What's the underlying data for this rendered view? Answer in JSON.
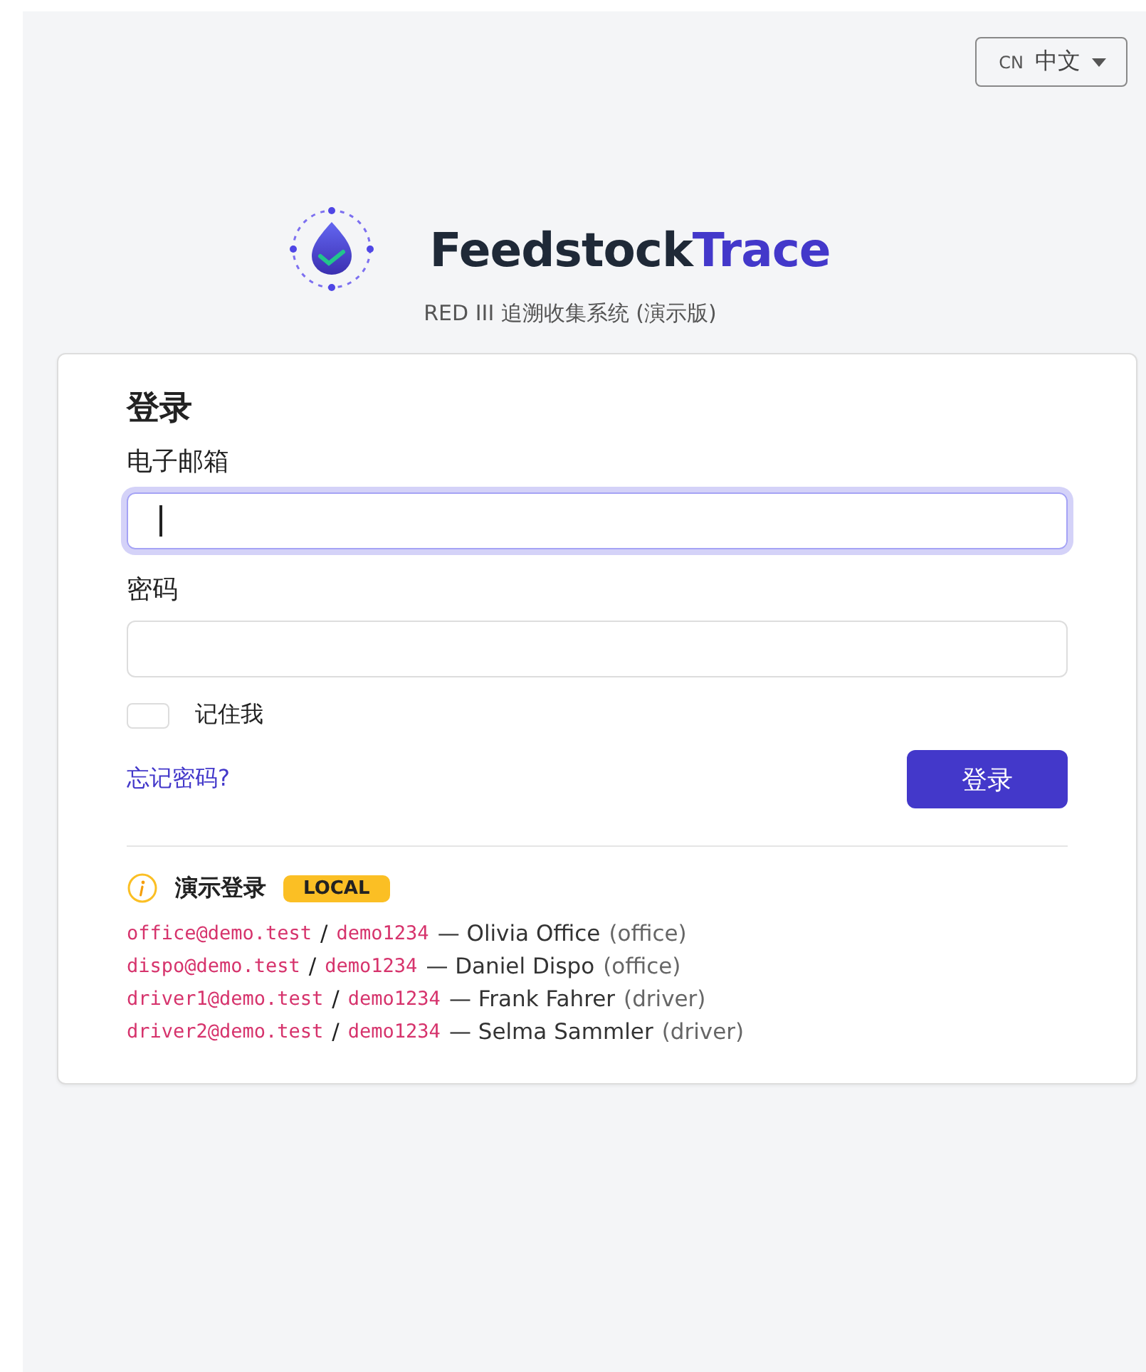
{
  "language": {
    "code": "CN",
    "label": "中文"
  },
  "brand": {
    "name": "Feedstock",
    "accent": "Trace",
    "subtitle": "RED III 追溯收集系统 (演示版)"
  },
  "login": {
    "title": "登录",
    "fields": [
      {
        "label": "电子邮箱",
        "focused": true
      },
      {
        "label": "密码",
        "focused": false
      }
    ],
    "remember": {
      "label": "记住我",
      "checked": false
    },
    "forgot_link": "忘记密码?",
    "submit": "登录"
  },
  "demo": {
    "title": "演示登录",
    "badge": "LOCAL",
    "accounts": [
      {
        "email": "office@demo.test",
        "slash": "/",
        "password": "demo1234",
        "person": "— Olivia Office",
        "role": "(office)"
      },
      {
        "email": "dispo@demo.test",
        "slash": "/",
        "password": "demo1234",
        "person": "— Daniel Dispo",
        "role": "(office)"
      },
      {
        "email": "driver1@demo.test",
        "slash": "/",
        "password": "demo1234",
        "person": "— Frank Fahrer",
        "role": "(driver)"
      },
      {
        "email": "driver2@demo.test",
        "slash": "/",
        "password": "demo1234",
        "person": "— Selma Sammler",
        "role": "(driver)"
      }
    ]
  }
}
